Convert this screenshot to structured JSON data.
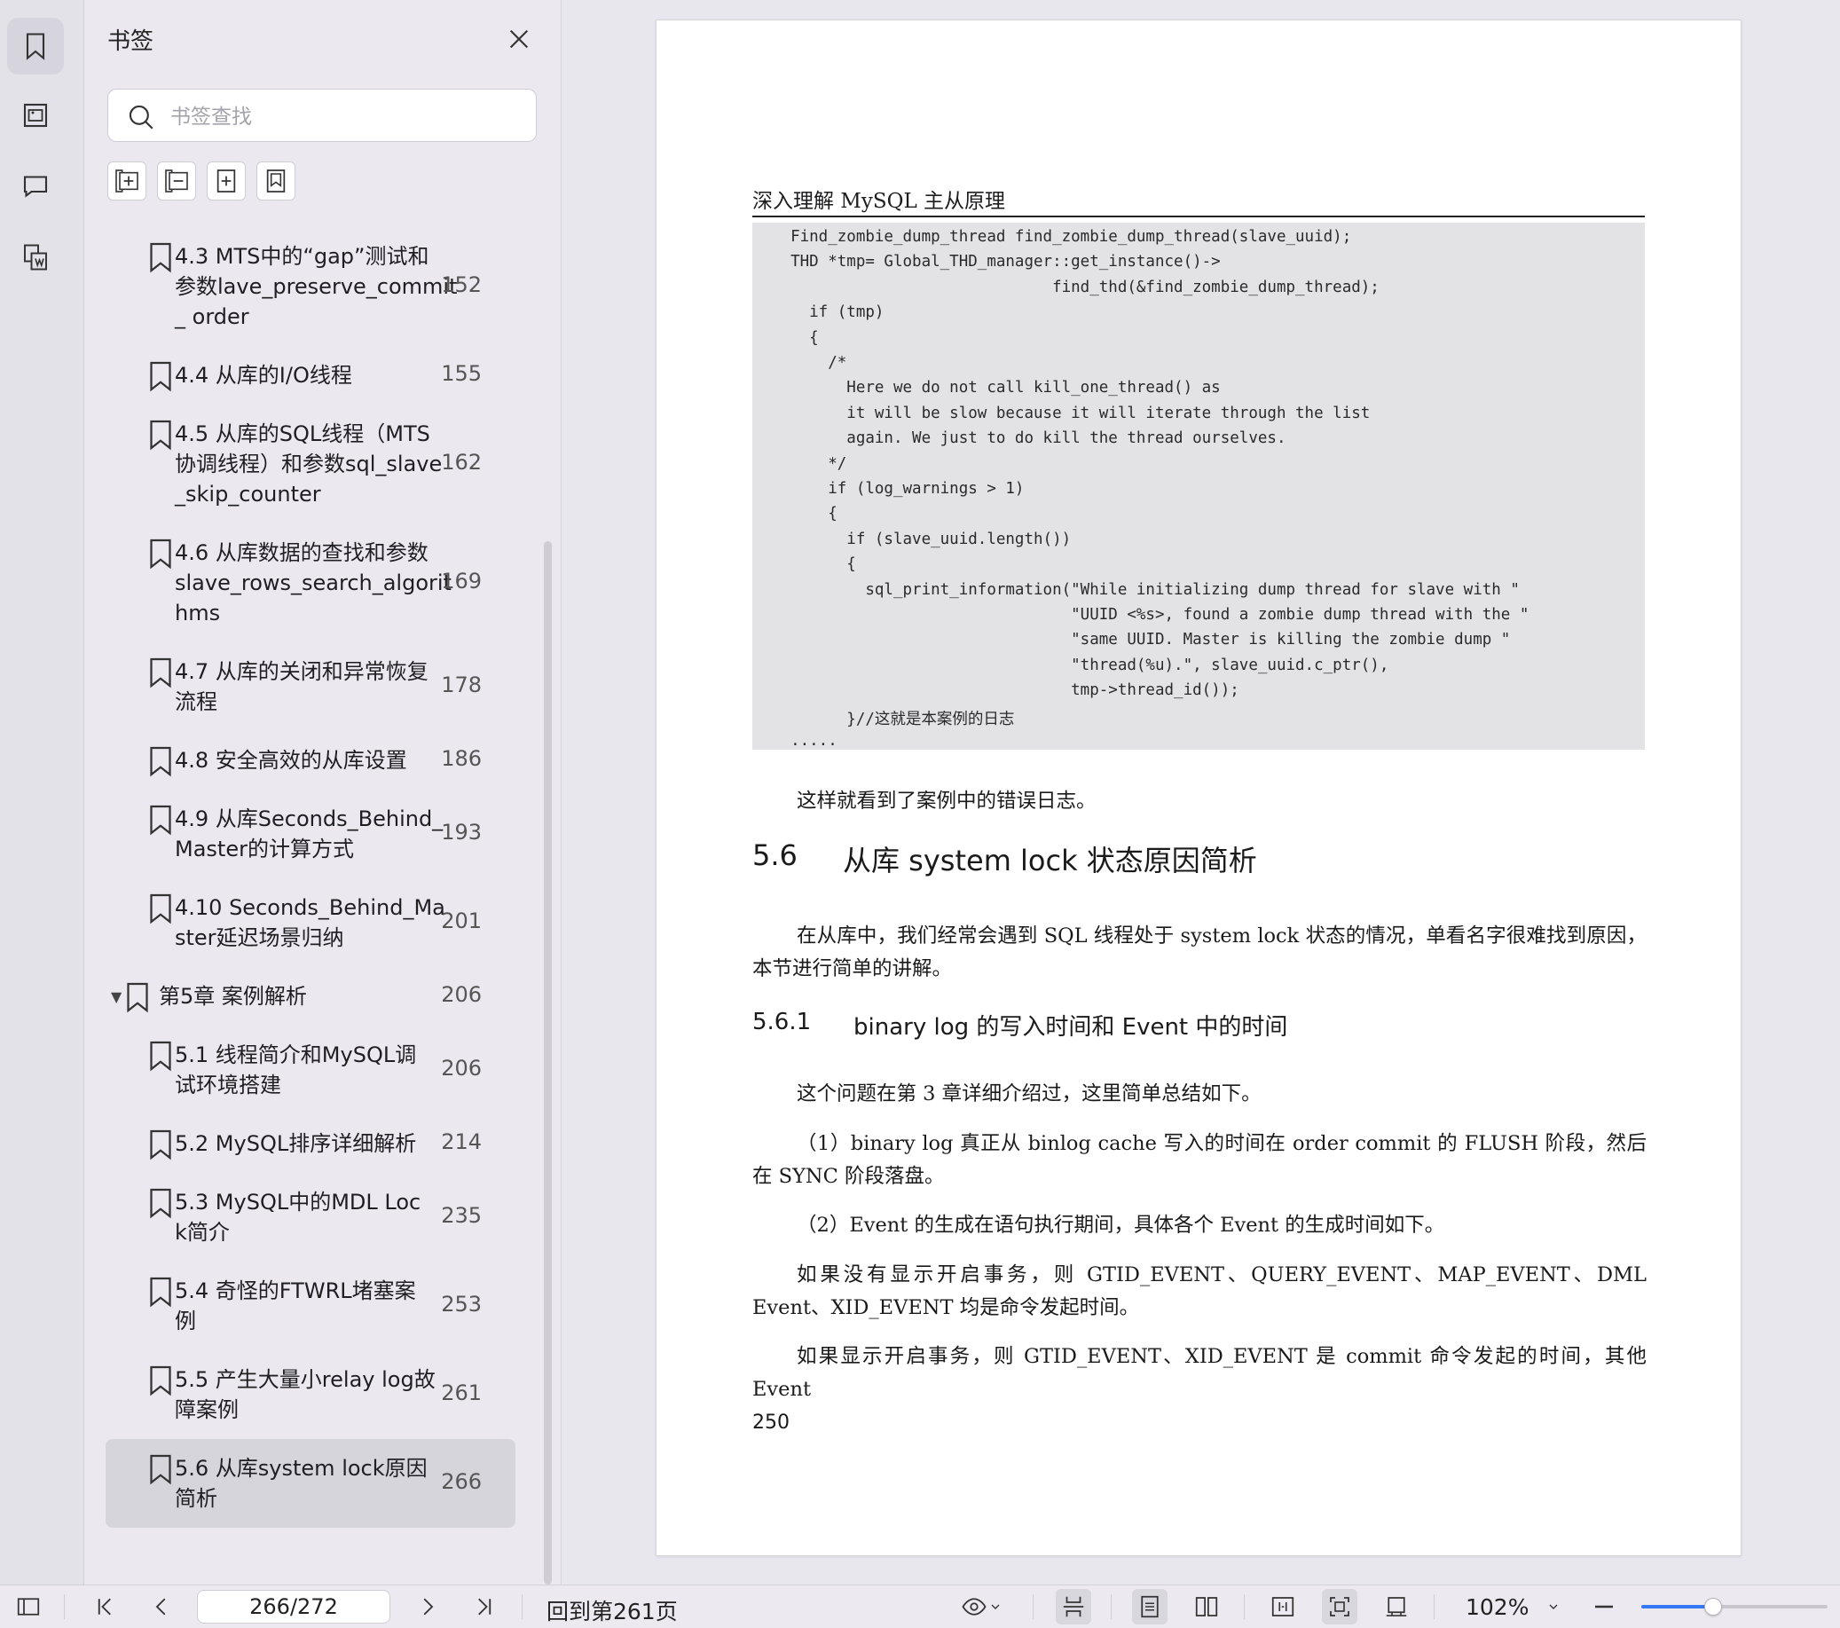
{
  "rail": {
    "items": [
      {
        "name": "bookmark-icon",
        "active": true
      },
      {
        "name": "thumbnail-icon",
        "active": false
      },
      {
        "name": "comment-icon",
        "active": false
      },
      {
        "name": "extract-icon",
        "active": false
      }
    ]
  },
  "panel": {
    "title": "书签",
    "search_placeholder": "书签查找",
    "tools": [
      "expand-all-icon",
      "collapse-all-icon",
      "add-bookmark-icon",
      "bookmark-outline-icon"
    ],
    "bookmarks": [
      {
        "lines": [
          "4.3 MTS中的“gap”测试和",
          "参数lave_preserve_commit",
          "_ order"
        ],
        "page": "152",
        "level": 2,
        "selected": false
      },
      {
        "lines": [
          "4.4 从库的I/O线程"
        ],
        "page": "155",
        "level": 2,
        "selected": false
      },
      {
        "lines": [
          "4.5 从库的SQL线程（MTS",
          "协调线程）和参数sql_slave",
          "_skip_counter"
        ],
        "page": "162",
        "level": 2,
        "selected": false
      },
      {
        "lines": [
          "4.6 从库数据的查找和参数",
          "slave_rows_search_algorit",
          "hms"
        ],
        "page": "169",
        "level": 2,
        "selected": false
      },
      {
        "lines": [
          "4.7 从库的关闭和异常恢复",
          "流程"
        ],
        "page": "178",
        "level": 2,
        "selected": false
      },
      {
        "lines": [
          "4.8 安全高效的从库设置"
        ],
        "page": "186",
        "level": 2,
        "selected": false
      },
      {
        "lines": [
          "4.9 从库Seconds_Behind_",
          "Master的计算方式"
        ],
        "page": "193",
        "level": 2,
        "selected": false
      },
      {
        "lines": [
          "4.10 Seconds_Behind_Ma",
          "ster延迟场景归纳"
        ],
        "page": "201",
        "level": 2,
        "selected": false
      },
      {
        "lines": [
          "第5章 案例解析"
        ],
        "page": "206",
        "level": 1,
        "selected": false,
        "expanded": true
      },
      {
        "lines": [
          "5.1 线程简介和MySQL调",
          "试环境搭建"
        ],
        "page": "206",
        "level": 2,
        "selected": false
      },
      {
        "lines": [
          "5.2 MySQL排序详细解析"
        ],
        "page": "214",
        "level": 2,
        "selected": false
      },
      {
        "lines": [
          "5.3 MySQL中的MDL Loc",
          "k简介"
        ],
        "page": "235",
        "level": 2,
        "selected": false
      },
      {
        "lines": [
          "5.4 奇怪的FTWRL堵塞案",
          "例"
        ],
        "page": "253",
        "level": 2,
        "selected": false
      },
      {
        "lines": [
          "5.5 产生大量小relay log故",
          "障案例"
        ],
        "page": "261",
        "level": 2,
        "selected": false
      },
      {
        "lines": [
          "5.6 从库system lock原因",
          "简析"
        ],
        "page": "266",
        "level": 2,
        "selected": true
      }
    ]
  },
  "document": {
    "running_header": "深入理解 MySQL 主从原理",
    "code_lines": [
      "  Find_zombie_dump_thread find_zombie_dump_thread(slave_uuid);",
      "  THD *tmp= Global_THD_manager::get_instance()->",
      "                              find_thd(&find_zombie_dump_thread);",
      "    if (tmp)",
      "    {",
      "      /*",
      "        Here we do not call kill_one_thread() as",
      "        it will be slow because it will iterate through the list",
      "        again. We just to do kill the thread ourselves.",
      "      */",
      "      if (log_warnings > 1)",
      "      {",
      "        if (slave_uuid.length())",
      "        {",
      "          sql_print_information(\"While initializing dump thread for slave with \"",
      "                                \"UUID <%s>, found a zombie dump thread with the \"",
      "                                \"same UUID. Master is killing the zombie dump \"",
      "                                \"thread(%u).\", slave_uuid.c_ptr(),",
      "                                tmp->thread_id());",
      "        }//这就是本案例的日志",
      "  ....."
    ],
    "para_after_code": "这样就看到了案例中的错误日志。",
    "section_number": "5.6",
    "section_title": "从库 system lock 状态原因简析",
    "section_intro": "在从库中，我们经常会遇到 SQL 线程处于 system lock 状态的情况，单看名字很难找到原因，本节进行简单的讲解。",
    "subsection_number": "5.6.1",
    "subsection_title": "binary log 的写入时间和 Event 中的时间",
    "p1": "这个问题在第 3 章详细介绍过，这里简单总结如下。",
    "p2": "（1）binary log 真正从 binlog cache 写入的时间在 order commit 的 FLUSH 阶段，然后在 SYNC 阶段落盘。",
    "p3": "（2）Event 的生成在语句执行期间，具体各个 Event 的生成时间如下。",
    "p4": "如果没有显示开启事务，则 GTID_EVENT、QUERY_EVENT、MAP_EVENT、DML Event、XID_EVENT 均是命令发起时间。",
    "p5": "如果显示开启事务，则 GTID_EVENT、XID_EVENT 是 commit 命令发起的时间，其他 Event",
    "page_number": "250"
  },
  "toolbar": {
    "page_field": "266/272",
    "goto_label": "回到第261页",
    "zoom": "102%",
    "zoom_slider_fraction": 0.38
  }
}
